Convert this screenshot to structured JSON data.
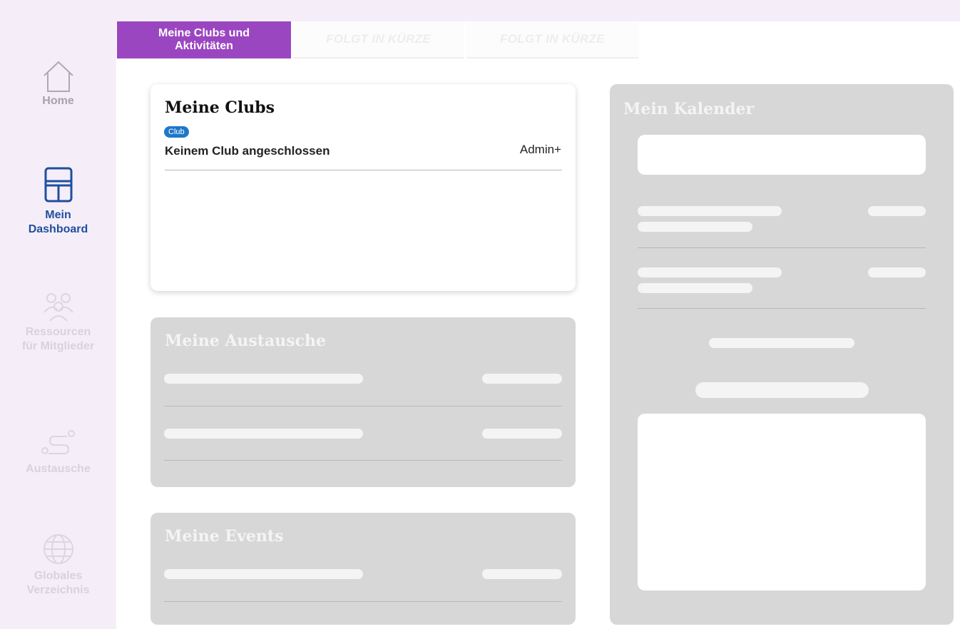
{
  "sidebar": {
    "items": [
      {
        "label": "Home",
        "icon": "home-icon"
      },
      {
        "label": "Mein Dashboard",
        "icon": "dashboard-icon"
      },
      {
        "label": "Ressourcen für Mitglieder",
        "icon": "people-icon"
      },
      {
        "label": "Austausche",
        "icon": "route-icon"
      },
      {
        "label": "Globales Verzeichnis",
        "icon": "globe-icon"
      }
    ]
  },
  "tabs": [
    {
      "label": "Meine Clubs und Aktivitäten",
      "active": true
    },
    {
      "label": "FOLGT IN KÜRZE",
      "active": false
    },
    {
      "label": "FOLGT IN KÜRZE",
      "active": false
    }
  ],
  "clubs": {
    "title": "Meine Clubs",
    "badge": "Club",
    "row_text": "Keinem Club angeschlossen",
    "role": "Admin+"
  },
  "austausche": {
    "title": "Meine Austausche"
  },
  "events": {
    "title": "Meine Events"
  },
  "kalender": {
    "title": "Mein Kalender"
  },
  "colors": {
    "accent": "#9b46c1",
    "active_nav": "#1f4fa0",
    "badge": "#1f77c9",
    "placeholder": "#d7d7d7"
  }
}
